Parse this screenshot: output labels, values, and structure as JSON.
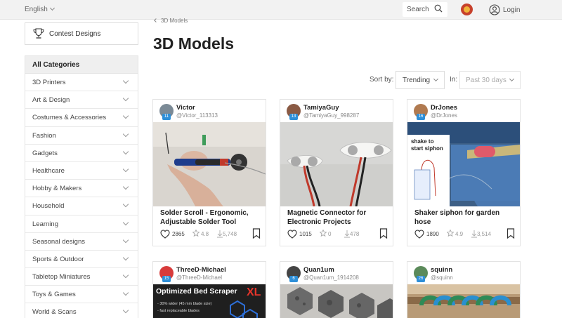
{
  "topbar": {
    "language": "English",
    "search_label": "Search",
    "login_label": "Login"
  },
  "sidebar": {
    "contest_label": "Contest Designs",
    "all_categories": "All Categories",
    "categories": [
      "3D Printers",
      "Art & Design",
      "Costumes & Accessories",
      "Fashion",
      "Gadgets",
      "Healthcare",
      "Hobby & Makers",
      "Household",
      "Learning",
      "Seasonal designs",
      "Sports & Outdoor",
      "Tabletop Miniatures",
      "Toys & Games",
      "World & Scans"
    ]
  },
  "main": {
    "breadcrumb": "3D Models",
    "title": "3D Models",
    "sort_label": "Sort by:",
    "sort_value": "Trending",
    "in_label": "In:",
    "in_value": "Past 30 days"
  },
  "cards": [
    {
      "user": "Victor",
      "handle": "@Victor_113313",
      "level": "11",
      "avatar_color": "#7b8a96",
      "title": "Solder Scroll - Ergonomic, Adjustable Solder Tool",
      "likes": "2865",
      "rating": "4.8",
      "downloads": "5,748"
    },
    {
      "user": "TamiyaGuy",
      "handle": "@TamiyaGuy_998287",
      "level": "13",
      "avatar_color": "#8a5a44",
      "title": "Magnetic Connector for Electronic Projects",
      "likes": "1015",
      "rating": "0",
      "downloads": "478"
    },
    {
      "user": "DrJones",
      "handle": "@DrJones",
      "level": "16",
      "avatar_color": "#b07a50",
      "title": "Shaker siphon for garden hose",
      "likes": "1890",
      "rating": "4.9",
      "downloads": "3,514"
    },
    {
      "user": "ThreeD-Michael",
      "handle": "@ThreeD-Michael",
      "level": "15",
      "avatar_color": "#d83b3b"
    },
    {
      "user": "Quan1um",
      "handle": "@Quan1um_1914208",
      "level": "6",
      "avatar_color": "#444444"
    },
    {
      "user": "squinn",
      "handle": "@squinn",
      "level": "26",
      "avatar_color": "#5b8a5a"
    }
  ],
  "thumb_texts": {
    "siphon_caption_1": "shake to",
    "siphon_caption_2": "start siphon",
    "scraper_title": "Optimized Bed Scraper",
    "scraper_badge": "XL",
    "scraper_line_1": "- 30% wider (45 mm blade size)",
    "scraper_line_2": "- fast replaceable blades"
  }
}
